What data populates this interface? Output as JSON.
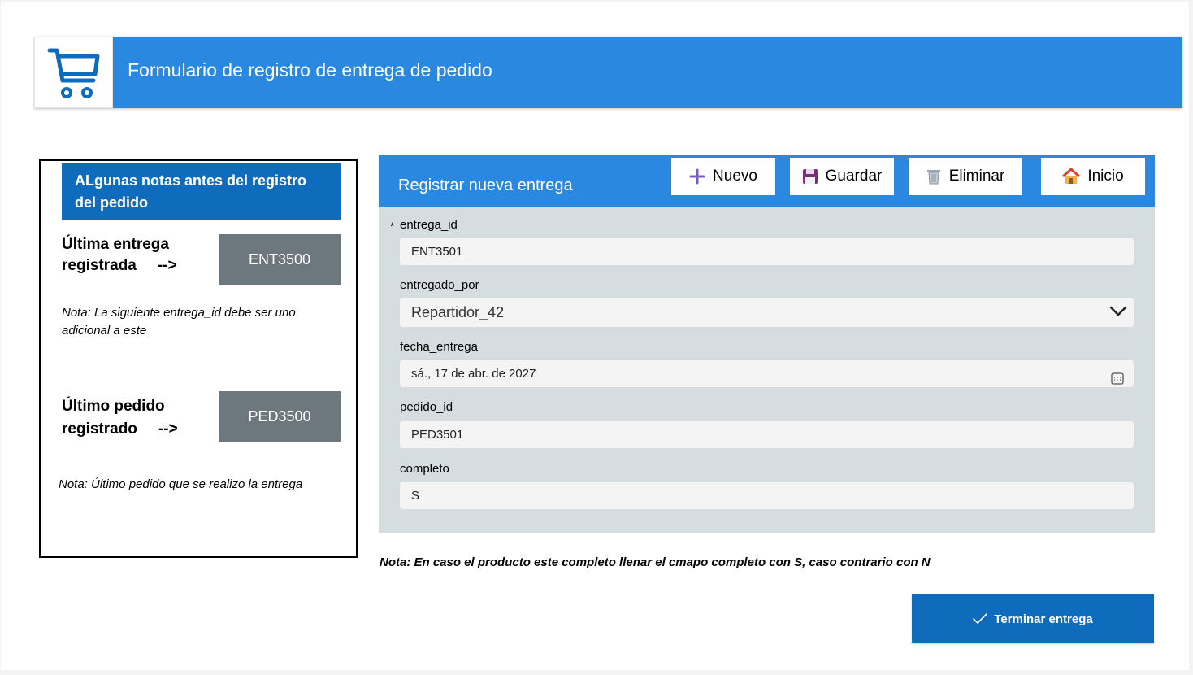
{
  "header": {
    "title": "Formulario de registro de entrega de pedido",
    "logo_icon": "shopping-cart-icon"
  },
  "notes": {
    "title": "ALgunas notas antes del registro del pedido",
    "last_delivery": {
      "label_line1": "Última entrega",
      "label_line2": "registrada",
      "arrow": "-->",
      "value": "ENT3500",
      "note": "Nota: La siguiente entrega_id debe ser uno adicional a este"
    },
    "last_order": {
      "label_line1": "Último pedido",
      "label_line2": "registrado",
      "arrow": "-->",
      "value": "PED3500",
      "note": "Nota: Último pedido que se realizo la entrega"
    }
  },
  "form": {
    "title": "Registrar nueva entrega",
    "toolbar": {
      "new_label": "Nuevo",
      "save_label": "Guardar",
      "delete_label": "Eliminar",
      "home_label": "Inicio"
    },
    "required_marker": "*",
    "fields": {
      "entrega_id": {
        "label": "entrega_id",
        "value": "ENT3501"
      },
      "entregado_por": {
        "label": "entregado_por",
        "value": "Repartidor_42"
      },
      "fecha_entrega": {
        "label": "fecha_entrega",
        "value": "sá., 17 de abr. de 2027"
      },
      "pedido_id": {
        "label": "pedido_id",
        "value": "PED3501"
      },
      "completo": {
        "label": "completo",
        "value": "S"
      }
    }
  },
  "bottom_note": "Nota: En caso el producto este completo llenar el cmapo completo con S, caso contrario con N",
  "finish_button": {
    "label": "Terminar entrega",
    "icon": "checkmark-icon"
  },
  "colors": {
    "header_blue": "#2b88e0",
    "dark_blue": "#0f6cbd",
    "code_box_gray": "#6d787e",
    "form_bg": "#d6dde1"
  }
}
